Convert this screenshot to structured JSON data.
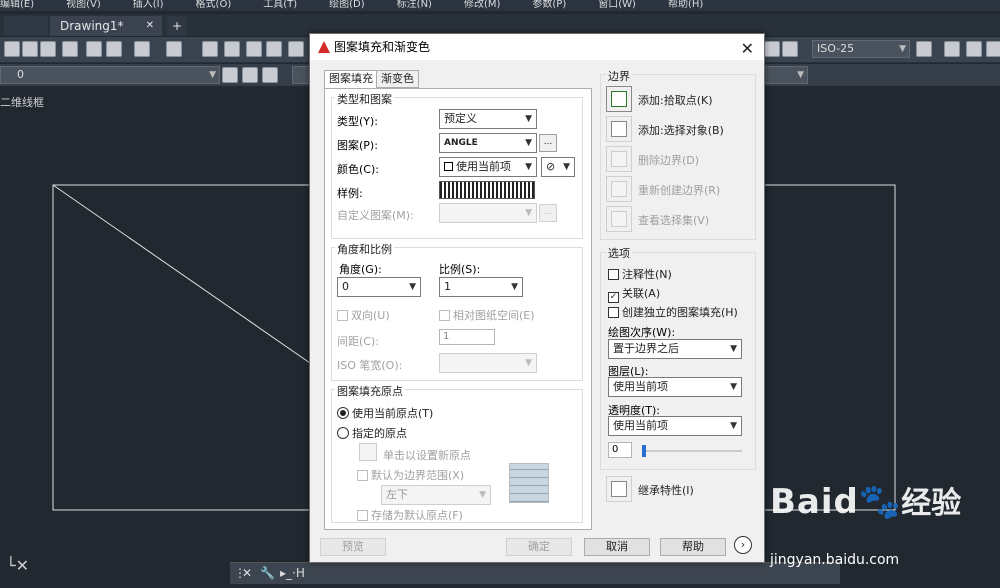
{
  "menu": [
    "编辑(E)",
    "视图(V)",
    "插入(I)",
    "格式(O)",
    "工具(T)",
    "绘图(D)",
    "标注(N)",
    "修改(M)",
    "参数(P)",
    "窗口(W)",
    "帮助(H)"
  ],
  "tabs": {
    "drawing": "Drawing1*",
    "close": "✕",
    "add": "+"
  },
  "toolbar": {
    "layer_value": "0",
    "dim_style": "ISO-25"
  },
  "viewport_label": "二维线框",
  "command_prompt": "▸_·H",
  "watermark": {
    "logo": "Baid",
    "text": "经验",
    "url": "jingyan.baidu.com"
  },
  "dialog": {
    "title": "图案填充和渐变色",
    "close": "✕",
    "tabs": [
      "图案填充",
      "渐变色"
    ],
    "type_group": {
      "title": "类型和图案",
      "type_label": "类型(Y):",
      "type_value": "预定义",
      "pattern_label": "图案(P):",
      "pattern_value": "ANGLE",
      "pattern_more": "...",
      "color_label": "颜色(C):",
      "color_value": "使用当前项",
      "swatch_label": "样例:",
      "custom_label": "自定义图案(M):",
      "custom_more": "..."
    },
    "angle_group": {
      "title": "角度和比例",
      "angle_label": "角度(G):",
      "angle_value": "0",
      "scale_label": "比例(S):",
      "scale_value": "1",
      "double_label": "双向(U)",
      "relative_label": "相对图纸空间(E)",
      "spacing_label": "间距(C):",
      "spacing_value": "1",
      "iso_label": "ISO 笔宽(O):"
    },
    "origin_group": {
      "title": "图案填充原点",
      "use_current": "使用当前原点(T)",
      "specified": "指定的原点",
      "click_set": "单击以设置新原点",
      "default_extent": "默认为边界范围(X)",
      "position_value": "左下",
      "store_default": "存储为默认原点(F)"
    },
    "boundaries": {
      "title": "边界",
      "add_pick": "添加:拾取点(K)",
      "add_select": "添加:选择对象(B)",
      "remove": "删除边界(D)",
      "recreate": "重新创建边界(R)",
      "view_selection": "查看选择集(V)"
    },
    "options": {
      "title": "选项",
      "annotative": "注释性(N)",
      "associative": "关联(A)",
      "separate": "创建独立的图案填充(H)",
      "draw_order_label": "绘图次序(W):",
      "draw_order_value": "置于边界之后",
      "layer_label": "图层(L):",
      "layer_value": "使用当前项",
      "transparency_label": "透明度(T):",
      "transparency_value": "使用当前项",
      "transparency_level": "0"
    },
    "inherit": "继承特性(I)",
    "footer": {
      "preview": "预览",
      "ok": "确定",
      "cancel": "取消",
      "help": "帮助",
      "more": "›"
    }
  }
}
